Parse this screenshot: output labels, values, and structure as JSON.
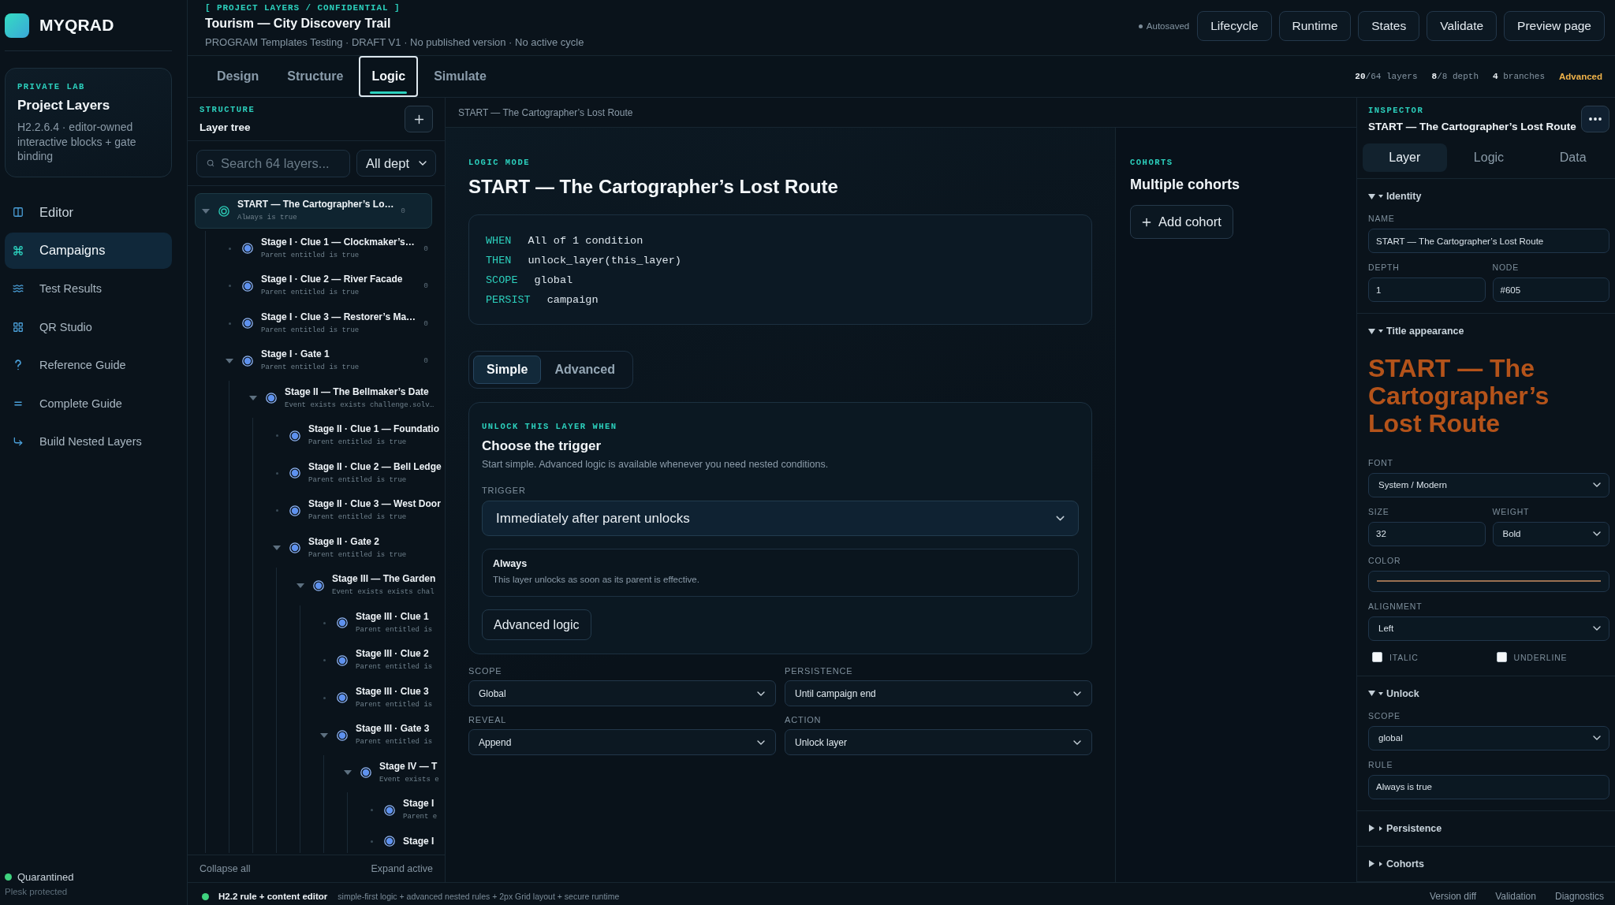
{
  "sidebar": {
    "logo": "MYQRAD",
    "card": {
      "eyebrow": "PRIVATE LAB",
      "title": "Project Layers",
      "text": "H2.2.6.4 · editor-owned interactive blocks + gate binding"
    },
    "nav": [
      {
        "label": "Editor",
        "kind": "primary",
        "selected": false
      },
      {
        "label": "Campaigns",
        "kind": "primary",
        "selected": true
      },
      {
        "label": "Test Results",
        "kind": "secondary",
        "selected": false
      },
      {
        "label": "QR Studio",
        "kind": "secondary",
        "selected": false
      },
      {
        "label": "Reference Guide",
        "kind": "secondary",
        "selected": false
      },
      {
        "label": "Complete Guide",
        "kind": "secondary",
        "selected": false
      },
      {
        "label": "Build Nested Layers",
        "kind": "secondary",
        "selected": false
      }
    ],
    "status": {
      "label": "Quarantined",
      "note": "Plesk protected"
    }
  },
  "header": {
    "breadcrumb": "[ PROJECT LAYERS / CONFIDENTIAL ]",
    "title": "Tourism — City Discovery Trail",
    "subtitle": "PROGRAM Templates Testing · DRAFT V1 · No published version · No active cycle",
    "autosave": "Autosaved",
    "buttons": [
      "Lifecycle",
      "Runtime",
      "States",
      "Validate",
      "Preview page"
    ]
  },
  "tabs": [
    {
      "label": "Design",
      "selected": false
    },
    {
      "label": "Structure",
      "selected": false
    },
    {
      "label": "Logic",
      "selected": true
    },
    {
      "label": "Simulate",
      "selected": false
    }
  ],
  "stats": [
    "**20**/64 layers",
    "**8**/8 depth",
    "**4** branches"
  ],
  "mode": "Advanced",
  "structure": {
    "eyebrow": "STRUCTURE",
    "title": "Layer tree",
    "search": {
      "placeholder": "Search 64 layers..."
    },
    "depth_filter": "All dept",
    "tree": [
      {
        "kind": "root",
        "title": "START — The Cartographer’s Lo…",
        "subtitle": "Always is true",
        "count": "0",
        "selected": true,
        "expanded": true,
        "children": [
          {
            "kind": "leaf",
            "title": "Stage I · Clue 1 — Clockmaker’s…",
            "subtitle": "Parent entitled is true",
            "count": "0",
            "selected": false
          },
          {
            "kind": "leaf",
            "title": "Stage I · Clue 2 — River Facade",
            "subtitle": "Parent entitled is true",
            "count": "0",
            "selected": false
          },
          {
            "kind": "leaf",
            "title": "Stage I · Clue 3 — Restorer’s Ma…",
            "subtitle": "Parent entitled is true",
            "count": "0",
            "selected": false
          },
          {
            "kind": "branch",
            "title": "Stage I · Gate 1",
            "subtitle": "Parent entitled is true",
            "count": "0",
            "selected": false,
            "expanded": true,
            "children": [
              {
                "kind": "branch",
                "title": "Stage II — The Bellmaker’s Date",
                "subtitle": "Event exists exists challenge.solv…",
                "selected": false,
                "expanded": true,
                "children": [
                  {
                    "kind": "leaf",
                    "title": "Stage II · Clue 1 — Foundatio",
                    "subtitle": "Parent entitled is true",
                    "selected": false
                  },
                  {
                    "kind": "leaf",
                    "title": "Stage II · Clue 2 — Bell Ledge",
                    "subtitle": "Parent entitled is true",
                    "selected": false
                  },
                  {
                    "kind": "leaf",
                    "title": "Stage II · Clue 3 — West Door",
                    "subtitle": "Parent entitled is true",
                    "selected": false
                  },
                  {
                    "kind": "branch",
                    "title": "Stage II · Gate 2",
                    "subtitle": "Parent entitled is true",
                    "selected": false,
                    "expanded": true,
                    "children": [
                      {
                        "kind": "branch",
                        "title": "Stage III — The Garden",
                        "subtitle": "Event exists exists chal",
                        "selected": false,
                        "expanded": true,
                        "children": [
                          {
                            "kind": "leaf",
                            "title": "Stage III · Clue 1",
                            "subtitle": "Parent entitled is",
                            "selected": false
                          },
                          {
                            "kind": "leaf",
                            "title": "Stage III · Clue 2",
                            "subtitle": "Parent entitled is",
                            "selected": false
                          },
                          {
                            "kind": "leaf",
                            "title": "Stage III · Clue 3",
                            "subtitle": "Parent entitled is",
                            "selected": false
                          },
                          {
                            "kind": "branch",
                            "title": "Stage III · Gate 3",
                            "subtitle": "Parent entitled is",
                            "selected": false,
                            "expanded": true,
                            "children": [
                              {
                                "kind": "branch",
                                "title": "Stage IV — T",
                                "subtitle": "Event exists e",
                                "selected": false,
                                "expanded": true,
                                "children": [
                                  {
                                    "kind": "leaf",
                                    "title": "Stage I",
                                    "subtitle": "Parent e",
                                    "selected": false
                                  },
                                  {
                                    "kind": "leaf",
                                    "title": "Stage I",
                                    "selected": false
                                  }
                                ]
                              }
                            ]
                          }
                        ]
                      }
                    ]
                  }
                ]
              }
            ]
          }
        ]
      }
    ],
    "footer": [
      "Collapse all",
      "Expand active"
    ]
  },
  "editor": {
    "breadcrumb": "START — The Cartographer’s Lost Route",
    "eyebrow": "LOGIC MODE",
    "title": "START — The Cartographer’s Lost Route",
    "rule": [
      {
        "keyword": "WHEN",
        "value": "All of 1 condition"
      },
      {
        "keyword": "THEN",
        "value": "unlock_layer(this_layer)"
      },
      {
        "keyword": "SCOPE",
        "value": "global"
      },
      {
        "keyword": "PERSIST",
        "value": "campaign"
      }
    ],
    "modes": [
      {
        "label": "Simple",
        "selected": true
      },
      {
        "label": "Advanced",
        "selected": false
      }
    ],
    "unlock": {
      "eyebrow": "UNLOCK THIS LAYER WHEN",
      "title": "Choose the trigger",
      "text": "Start simple. Advanced logic is available whenever you need nested conditions.",
      "trigger": {
        "label": "TRIGGER",
        "value": "Immediately after parent unlocks"
      },
      "summary": {
        "title": "Always",
        "text": "This layer unlocks as soon as its parent is effective."
      },
      "button": "Advanced logic"
    },
    "fields": [
      {
        "label": "SCOPE",
        "value": "Global"
      },
      {
        "label": "PERSISTENCE",
        "value": "Until campaign end"
      },
      {
        "label": "REVEAL",
        "value": "Append"
      },
      {
        "label": "ACTION",
        "value": "Unlock layer"
      }
    ]
  },
  "cohorts": {
    "eyebrow": "COHORTS",
    "title": "Multiple cohorts",
    "button": "Add cohort"
  },
  "inspector": {
    "eyebrow": "INSPECTOR",
    "title": "START — The Cartographer’s Lost Route",
    "tabs": [
      {
        "label": "Layer",
        "selected": true
      },
      {
        "label": "Logic",
        "selected": false
      },
      {
        "label": "Data",
        "selected": false
      }
    ],
    "sections": [
      {
        "title": "Identity",
        "expanded": true,
        "rows": [
          [
            {
              "kind": "input",
              "label": "NAME",
              "value": "START — The Cartographer’s Lost Route"
            }
          ],
          [
            {
              "kind": "input",
              "label": "DEPTH",
              "value": "1"
            },
            {
              "kind": "input",
              "label": "NODE",
              "value": "#605"
            }
          ]
        ]
      },
      {
        "title": "Title appearance",
        "expanded": true,
        "rows": [
          [
            {
              "kind": "preview",
              "text": "START — The Cartographer’s Lost Route",
              "color": "#b4531a"
            }
          ],
          [
            {
              "kind": "select",
              "label": "FONT",
              "value": "System / Modern"
            }
          ],
          [
            {
              "kind": "input",
              "label": "SIZE",
              "value": "32"
            },
            {
              "kind": "select",
              "label": "WEIGHT",
              "value": "Bold"
            }
          ],
          [
            {
              "kind": "color",
              "label": "COLOR",
              "color": "#9a7152"
            }
          ],
          [
            {
              "kind": "select",
              "label": "ALIGNMENT",
              "value": "Left"
            }
          ],
          [
            {
              "kind": "checkbox",
              "label": "ITALIC",
              "checked": false
            },
            {
              "kind": "checkbox",
              "label": "UNDERLINE",
              "checked": false
            }
          ]
        ]
      },
      {
        "title": "Unlock",
        "expanded": true,
        "rows": [
          [
            {
              "kind": "select",
              "label": "SCOPE",
              "value": "global"
            }
          ],
          [
            {
              "kind": "input",
              "label": "RULE",
              "value": "Always is true"
            }
          ]
        ]
      },
      {
        "title": "Persistence",
        "expanded": false
      },
      {
        "title": "Cohorts",
        "expanded": false
      }
    ]
  },
  "status_bar": {
    "title": "H2.2 rule + content editor",
    "text": "simple-first logic + advanced nested rules + 2px Grid layout + secure runtime",
    "links": [
      "Version diff",
      "Validation",
      "Diagnostics"
    ]
  }
}
